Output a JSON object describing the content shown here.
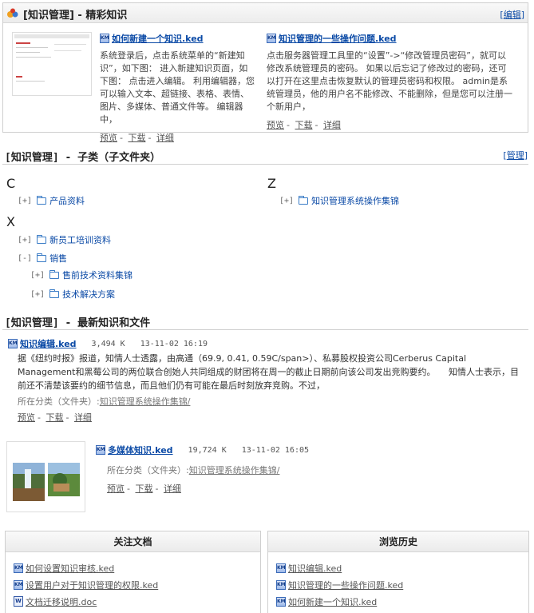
{
  "featured": {
    "title": "[知识管理] - 精彩知识",
    "edit_label": "编辑",
    "articles": [
      {
        "title": "如何新建一个知识.ked",
        "body": "系统登录后，点击系统菜单的“新建知识”，如下图： 进入新建知识页面，如下图： 点击进入编辑。 利用编辑器，您可以输入文本、超链接、表格、表情、图片、多媒体、普通文件等。 编辑器中，",
        "actions": [
          "预览",
          "下载",
          "详细"
        ]
      },
      {
        "title": "知识管理的一些操作问题.ked",
        "body": "点击服务器管理工具里的“设置”->“修改管理员密码”，就可以修改系统管理员的密码。 如果以后忘记了修改过的密码，还可以打开在这里点击恢复默认的管理员密码和权限。 admin是系统管理员，他的用户名不能修改、不能删除，但是您可以注册一个新用户，",
        "actions": [
          "预览",
          "下载",
          "详细"
        ]
      }
    ]
  },
  "subcat": {
    "title": "[知识管理] - 子类（子文件夹）",
    "manage_label": "管理",
    "groups": [
      {
        "letter": "C",
        "items": [
          {
            "toggle": "[+]",
            "label": "产品资料"
          }
        ]
      },
      {
        "letter": "Z",
        "items": [
          {
            "toggle": "[+]",
            "label": "知识管理系统操作集锦"
          }
        ]
      },
      {
        "letter": "X",
        "items": [
          {
            "toggle": "[+]",
            "label": "新员工培训资料"
          },
          {
            "toggle": "[-]",
            "label": "销售"
          },
          {
            "toggle": "[+]",
            "label": "售前技术资料集锦"
          },
          {
            "toggle": "[+]",
            "label": "技术解决方案"
          }
        ]
      }
    ]
  },
  "latest": {
    "title": "[知识管理] - 最新知识和文件",
    "items": [
      {
        "title": "知识编辑.ked",
        "size": "3,494 K",
        "date": "13-11-02 16:19",
        "body": "据《纽约时报》报道，知情人士透露，由高通（69.9, 0.41, 0.59C/span>）、私募股权投资公司Cerberus Capital Management和黑莓公司的两位联合创始人共同组成的财团将在周一的截止日期前向该公司发出竞购要约。　　知情人士表示，目前还不清楚该要约的细节信息，而且他们仍有可能在最后时刻放弃竞购。不过，",
        "category_label": "所在分类（文件夹）:",
        "category": "知识管理系统操作集锦/",
        "actions": [
          "预览",
          "下载",
          "详细"
        ]
      },
      {
        "title": "多媒体知识.ked",
        "size": "19,724 K",
        "date": "13-11-02 16:05",
        "category_label": "所在分类（文件夹）:",
        "category": "知识管理系统操作集锦/",
        "actions": [
          "预览",
          "下载",
          "详细"
        ]
      }
    ]
  },
  "followed": {
    "title": "关注文档",
    "items": [
      {
        "icon": "ked-icon",
        "label": "如何设置知识审核.ked"
      },
      {
        "icon": "ked-icon",
        "label": "设置用户对于知识管理的权限.ked"
      },
      {
        "icon": "doc-icon",
        "label": "文档迁移说明.doc"
      }
    ]
  },
  "history": {
    "title": "浏览历史",
    "items": [
      {
        "icon": "ked-icon",
        "label": "知识编辑.ked"
      },
      {
        "icon": "ked-icon",
        "label": "知识管理的一些操作问题.ked"
      },
      {
        "icon": "ked-icon",
        "label": "如何新建一个知识.ked"
      }
    ]
  },
  "icons": {
    "ked": "KM",
    "doc": "W"
  },
  "colors": {
    "link": "#0b4aa6",
    "border": "#cfcfcf",
    "header_bg": "#ececec"
  }
}
